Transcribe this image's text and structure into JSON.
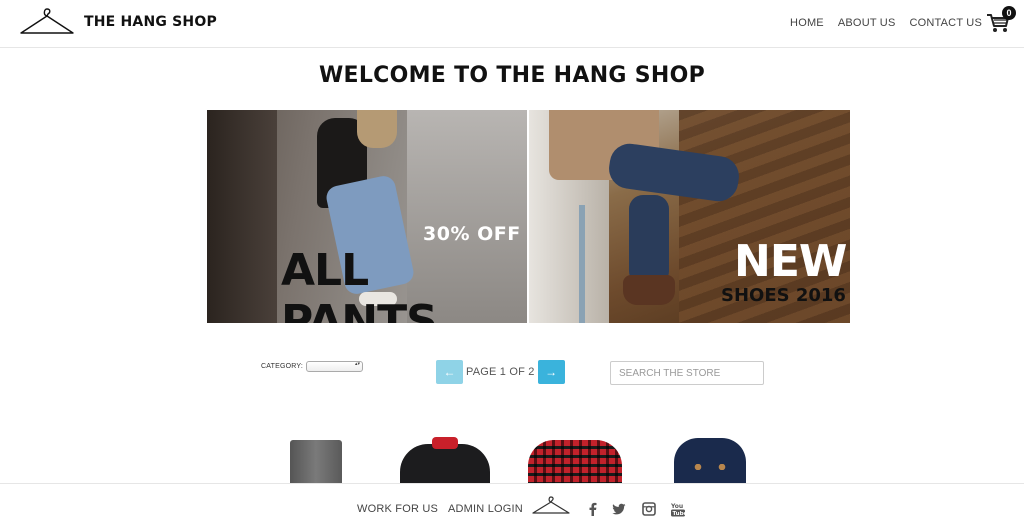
{
  "header": {
    "brand": "THE HANG SHOP",
    "nav": [
      "HOME",
      "ABOUT US",
      "CONTACT US"
    ],
    "cart_count": "0"
  },
  "main": {
    "title": "WELCOME TO THE HANG SHOP",
    "banners": [
      {
        "small_text": "30% OFF",
        "big_text": "ALL PANTS"
      },
      {
        "big_text": "NEW",
        "small_text": "SHOES 2016"
      }
    ]
  },
  "controls": {
    "category_label": "CATEGORY:",
    "page_text": "PAGE 1 OF 2",
    "search_placeholder": "SEARCH THE STORE"
  },
  "footer": {
    "links": [
      "WORK FOR US",
      "ADMIN LOGIN"
    ],
    "icons": [
      "hanger-icon",
      "facebook-icon",
      "twitter-icon",
      "instagram-icon",
      "youtube-icon"
    ]
  },
  "colors": {
    "accent": "#3ab3dc",
    "accent_light": "#8fd3e7"
  }
}
